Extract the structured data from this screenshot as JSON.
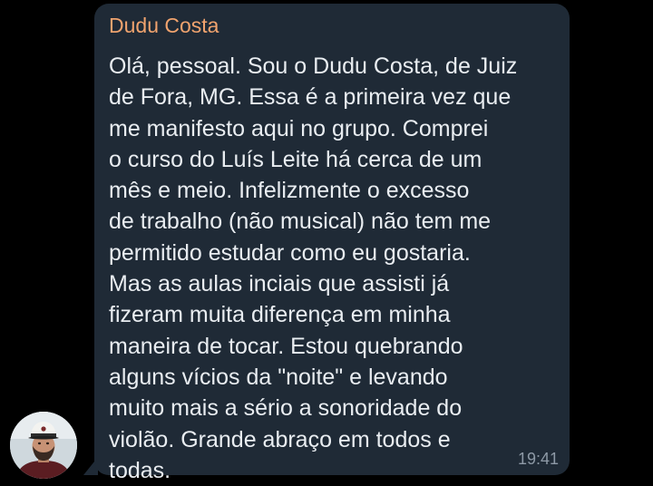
{
  "message": {
    "sender": "Dudu Costa",
    "lines": [
      "Olá, pessoal. Sou o Dudu Costa, de Juiz",
      "de Fora, MG. Essa é a primeira vez que",
      "me manifesto aqui no grupo. Comprei",
      "o curso do Luís Leite há cerca de um",
      "mês e meio. Infelizmente o excesso",
      "de trabalho (não musical) não tem me",
      "permitido estudar como eu gostaria.",
      "Mas as aulas inciais que assisti já",
      "fizeram muita diferença em minha",
      "maneira de tocar. Estou quebrando",
      "alguns vícios da \"noite\" e levando",
      "muito mais a sério a sonoridade do",
      "violão. Grande abraço em todos e",
      "todas."
    ],
    "time": "19:41"
  },
  "colors": {
    "background": "#000000",
    "bubble": "#1f2a36",
    "sender_name": "#f0a36e",
    "text": "#e9edf1",
    "timestamp": "#8d99a6"
  },
  "avatar": {
    "icon": "user-photo-avatar"
  }
}
